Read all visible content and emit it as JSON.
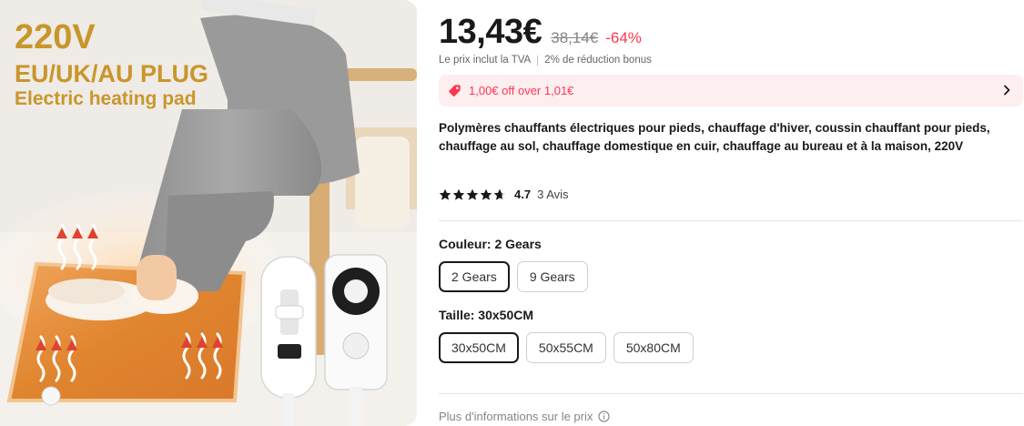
{
  "product_image": {
    "voltage_text": "220V",
    "plug_text": "EU/UK/AU PLUG",
    "description_text": "Electric heating pad"
  },
  "price": {
    "current": "13,43€",
    "original": "38,14€",
    "discount": "-64%",
    "tax_note": "Le prix inclut la TVA",
    "bonus_note": "2% de réduction bonus"
  },
  "coupon": {
    "icon": "tag-icon",
    "text": "1,00€ off over 1,01€"
  },
  "product_title": "Polymères chauffants électriques pour pieds, chauffage d'hiver, coussin chauffant pour pieds, chauffage au sol, chauffage domestique en cuir, chauffage au bureau et à la maison, 220V",
  "rating": {
    "value": "4.7",
    "reviews": "3 Avis",
    "stars": 4.7
  },
  "color_option": {
    "label": "Couleur: 2 Gears",
    "options": [
      "2 Gears",
      "9 Gears"
    ],
    "selected": "2 Gears"
  },
  "size_option": {
    "label": "Taille: 30x50CM",
    "options": [
      "30x50CM",
      "50x55CM",
      "50x80CM"
    ],
    "selected": "30x50CM"
  },
  "footer": {
    "more_info": "Plus d'informations sur le prix"
  },
  "colors": {
    "price_accent": "#fd384f",
    "coupon_background": "#fdeef0",
    "hero_text": "#c9962b",
    "mat_orange": "#e38a3a"
  }
}
